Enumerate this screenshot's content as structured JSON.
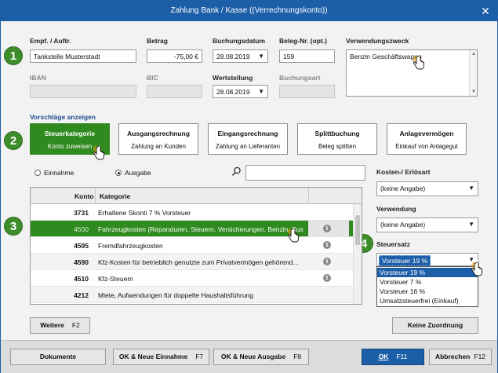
{
  "window": {
    "title": "Zahlung Bank / Kasse ((Verrechnungskonto))",
    "close": "✕"
  },
  "badges": [
    "1",
    "2",
    "3",
    "4"
  ],
  "fields": {
    "empf_label": "Empf. / Auftr.",
    "empf_value": "Tankstelle Musterstadt",
    "betrag_label": "Betrag",
    "betrag_value": "-75,00 €",
    "buchungsdatum_label": "Buchungsdatum",
    "buchungsdatum_value": "28.08.2019",
    "beleg_label": "Beleg-Nr. (opt.)",
    "beleg_value": "159",
    "verwendungszweck_label": "Verwendungszweck",
    "verwendungszweck_value": "Benzin Geschäftswagen",
    "iban_label": "IBAN",
    "bic_label": "BIC",
    "wertstellung_label": "Wertstellung",
    "wertstellung_value": "28.08.2019",
    "buchungsart_label": "Buchungsart"
  },
  "suggestions": {
    "link": "Vorschläge anzeigen",
    "buttons": [
      {
        "title": "Steuerkategorie",
        "sub": "Konto zuweisen"
      },
      {
        "title": "Ausgangsrechnung",
        "sub": "Zahlung an Kunden"
      },
      {
        "title": "Eingangsrechnung",
        "sub": "Zahlung an Lieferanten"
      },
      {
        "title": "Splittbuchung",
        "sub": "Beleg splitten"
      },
      {
        "title": "Anlagevermögen",
        "sub": "Einkauf von Anlagegut"
      }
    ]
  },
  "filter": {
    "einnahme": "Einnahme",
    "ausgabe": "Ausgabe",
    "search_value": ""
  },
  "grid": {
    "headers": {
      "konto": "Konto",
      "kategorie": "Kategorie"
    },
    "rows": [
      {
        "konto": "3731",
        "kategorie": "Erhaltene Skonti 7 % Vorsteuer",
        "info": ""
      },
      {
        "konto": "4500",
        "kategorie": "Fahrzeugkosten (Reparaturen, Steuern, Versicherungen, Benzin, Bus...",
        "info": "i"
      },
      {
        "konto": "4595",
        "kategorie": "Fremdfahrzeugkosten",
        "info": "i"
      },
      {
        "konto": "4590",
        "kategorie": "Kfz-Kosten für betrieblich genutzte zum Privatvermögen gehörend...",
        "info": "i"
      },
      {
        "konto": "4510",
        "kategorie": "Kfz-Steuern",
        "info": "i"
      },
      {
        "konto": "4212",
        "kategorie": "Miete, Aufwendungen für doppelte Haushaltsführung",
        "info": ""
      }
    ]
  },
  "right": {
    "kosten_label": "Kosten-/ Erlösart",
    "kosten_value": "(keine Angabe)",
    "verwendung_label": "Verwendung",
    "verwendung_value": "(keine Angabe)",
    "steuersatz_label": "Steuersatz",
    "steuersatz_value": "Vorsteuer 19 %",
    "options": [
      "Vorsteuer 19 %",
      "Vorsteuer 7 %",
      "Vorsteuer 16 %",
      "Umsatzsteuerfrei (Einkauf)"
    ]
  },
  "buttons": {
    "weitere": "Weitere",
    "weitere_key": "F2",
    "keine_zuordnung": "Keine Zuordnung",
    "dokumente": "Dokumente",
    "neue_einnahme": "OK & Neue Einnahme",
    "neue_einnahme_key": "F7",
    "neue_ausgabe": "OK & Neue Ausgabe",
    "neue_ausgabe_key": "F8",
    "ok": "OK",
    "ok_key": "F11",
    "abbrechen": "Abbrechen",
    "abbrechen_key": "F12"
  },
  "colors": {
    "accent": "#1d5ea8",
    "green": "#2f8a1f",
    "badge": "#3d8d2a"
  }
}
